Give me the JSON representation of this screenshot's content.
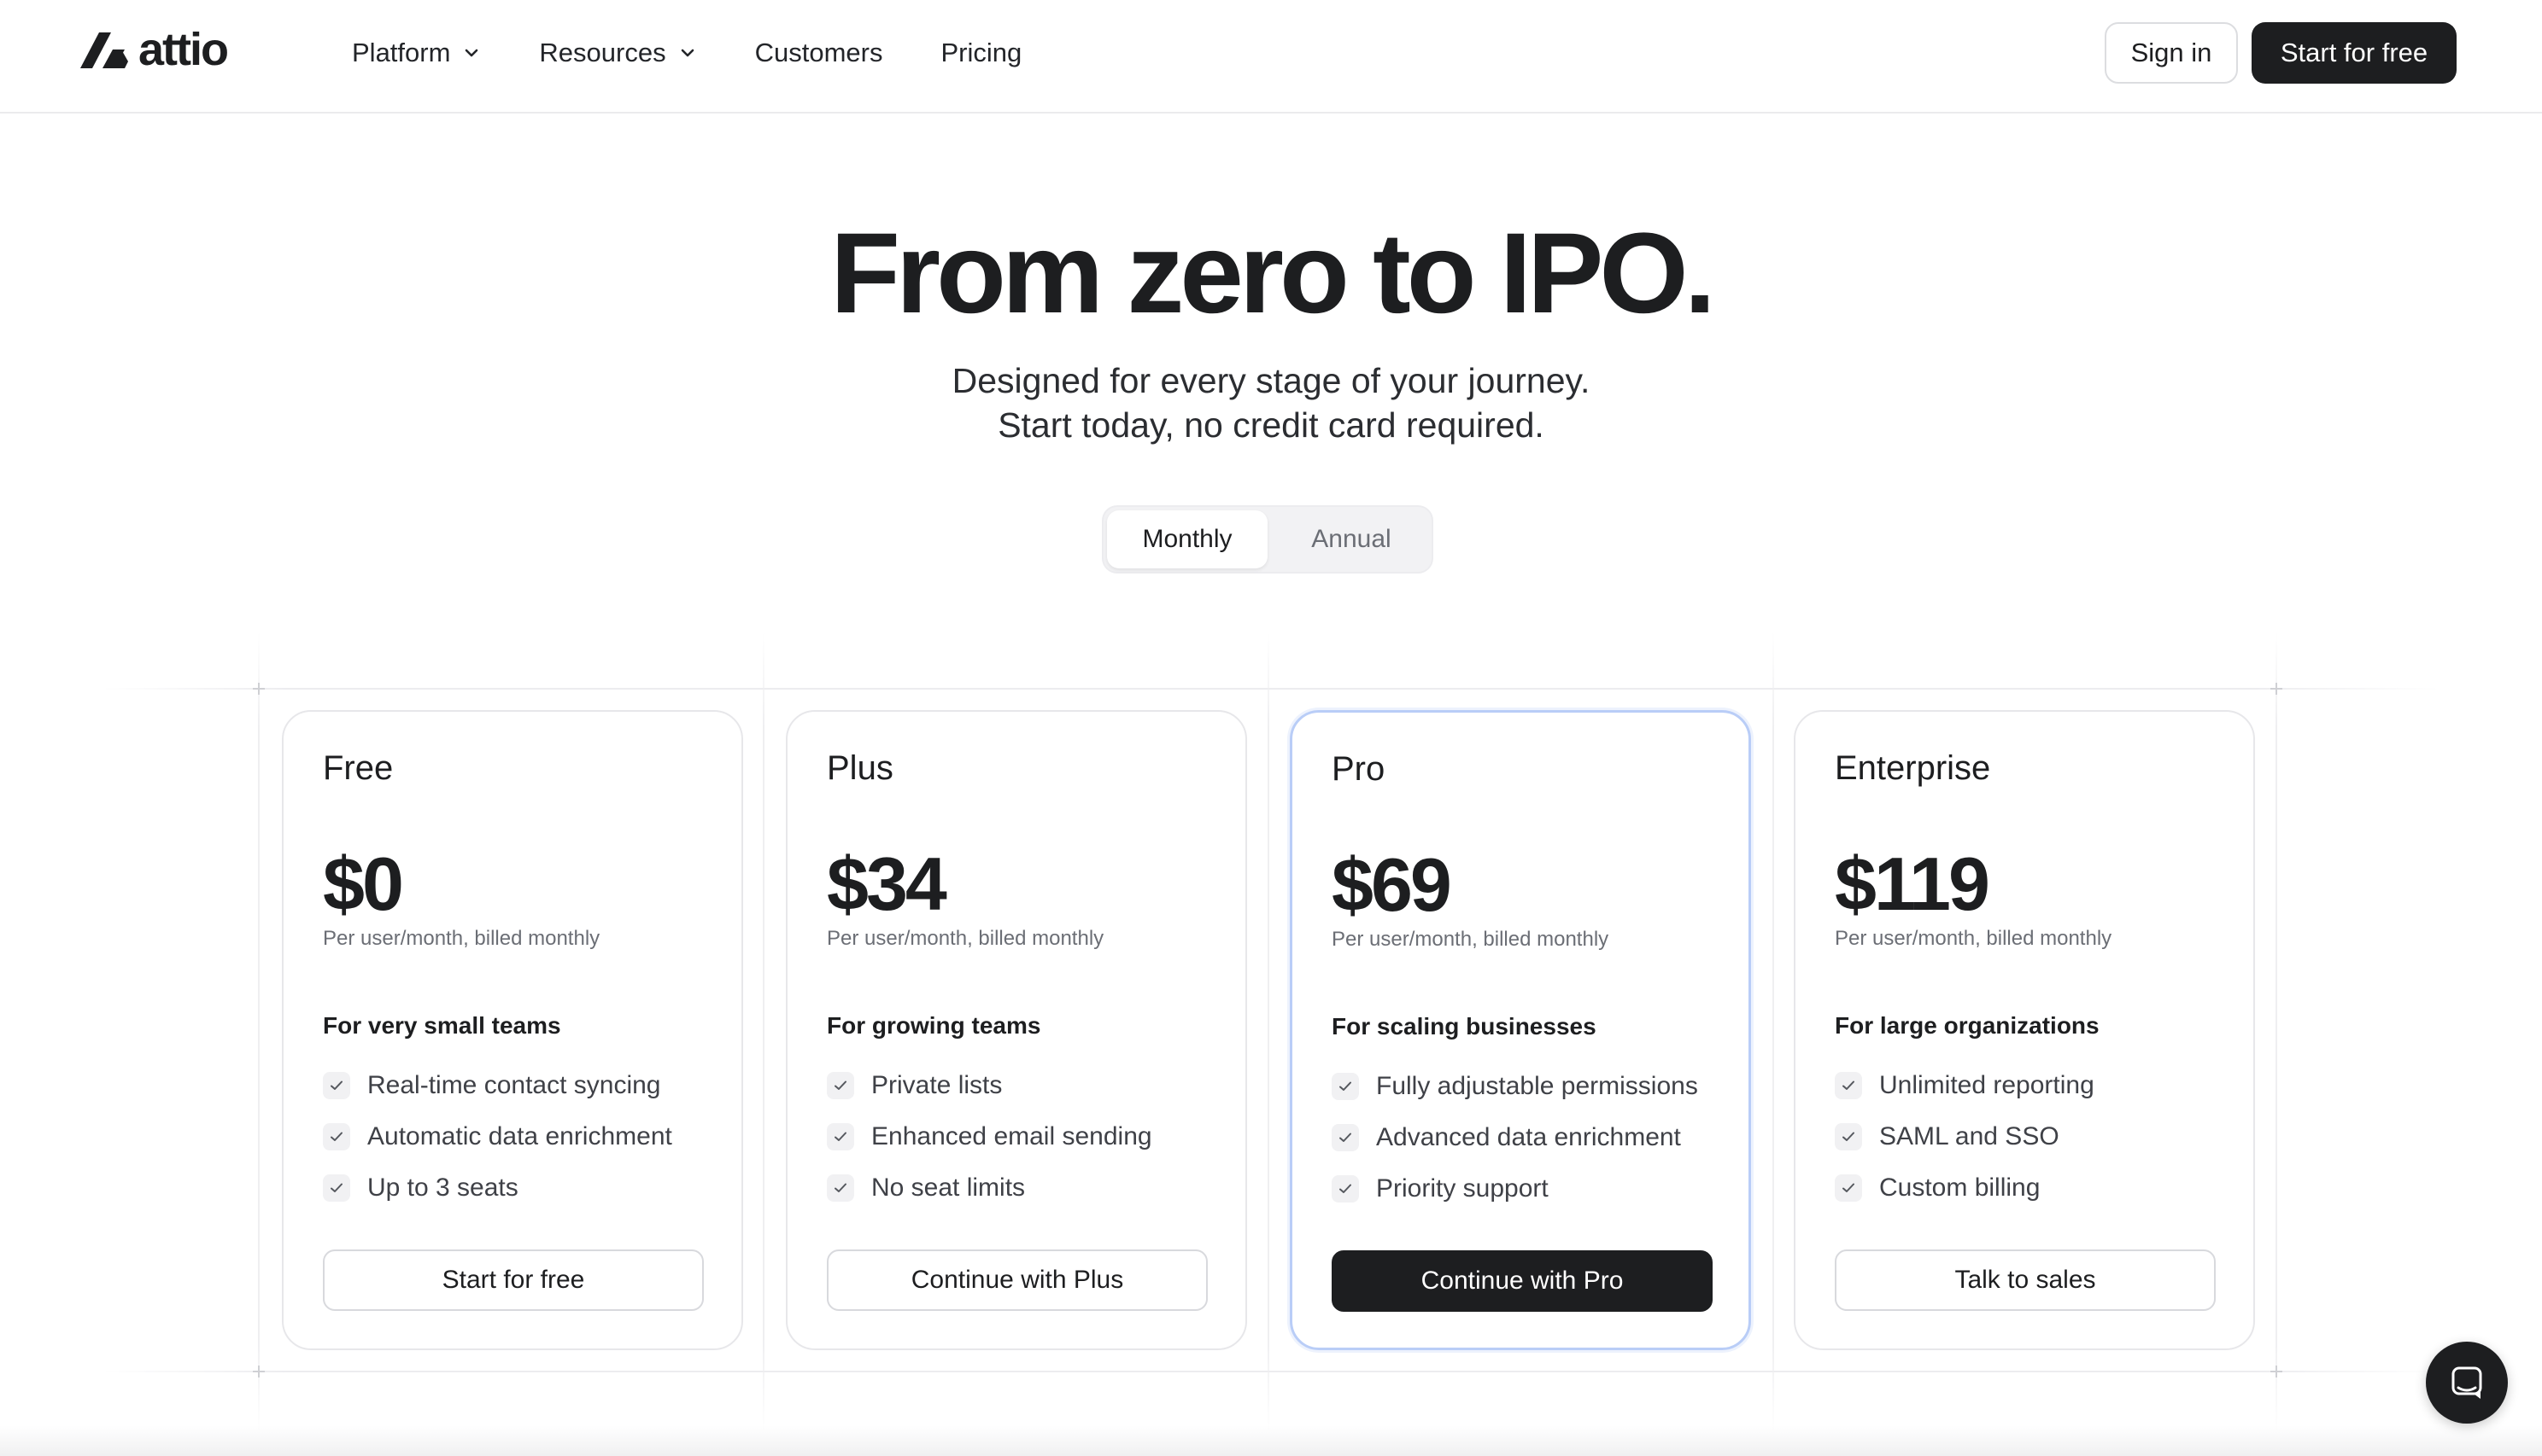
{
  "brand": {
    "name": "attio"
  },
  "nav": {
    "links": [
      {
        "label": "Platform",
        "dropdown": true
      },
      {
        "label": "Resources",
        "dropdown": true
      },
      {
        "label": "Customers",
        "dropdown": false
      },
      {
        "label": "Pricing",
        "dropdown": false
      }
    ],
    "sign_in": "Sign in",
    "start_free": "Start for free"
  },
  "hero": {
    "title": "From zero to IPO.",
    "subtitle_line1": "Designed for every stage of your journey.",
    "subtitle_line2": "Start today, no credit card required."
  },
  "billing_toggle": {
    "options": [
      "Monthly",
      "Annual"
    ],
    "selected": "Monthly"
  },
  "plans": [
    {
      "name": "Free",
      "price": "$0",
      "billing": "Per user/month, billed monthly",
      "audience": "For very small teams",
      "features": [
        "Real-time contact syncing",
        "Automatic data enrichment",
        "Up to 3 seats"
      ],
      "cta": "Start for free",
      "highlighted": false
    },
    {
      "name": "Plus",
      "price": "$34",
      "billing": "Per user/month, billed monthly",
      "audience": "For growing teams",
      "features": [
        "Private lists",
        "Enhanced email sending",
        "No seat limits"
      ],
      "cta": "Continue with Plus",
      "highlighted": false
    },
    {
      "name": "Pro",
      "price": "$69",
      "billing": "Per user/month, billed monthly",
      "audience": "For scaling businesses",
      "features": [
        "Fully adjustable permissions",
        "Advanced data enrichment",
        "Priority support"
      ],
      "cta": "Continue with Pro",
      "highlighted": true
    },
    {
      "name": "Enterprise",
      "price": "$119",
      "billing": "Per user/month, billed monthly",
      "audience": "For large organizations",
      "features": [
        "Unlimited reporting",
        "SAML and SSO",
        "Custom billing"
      ],
      "cta": "Talk to sales",
      "highlighted": false
    }
  ],
  "colors": {
    "text": "#1d1e20",
    "muted": "#6b6e75",
    "accent_border": "#b9cdf7",
    "dark_button": "#1d1e20"
  },
  "icons": {
    "chat": "chat-bubble-icon",
    "check": "check-icon",
    "chevron": "chevron-down-icon"
  }
}
